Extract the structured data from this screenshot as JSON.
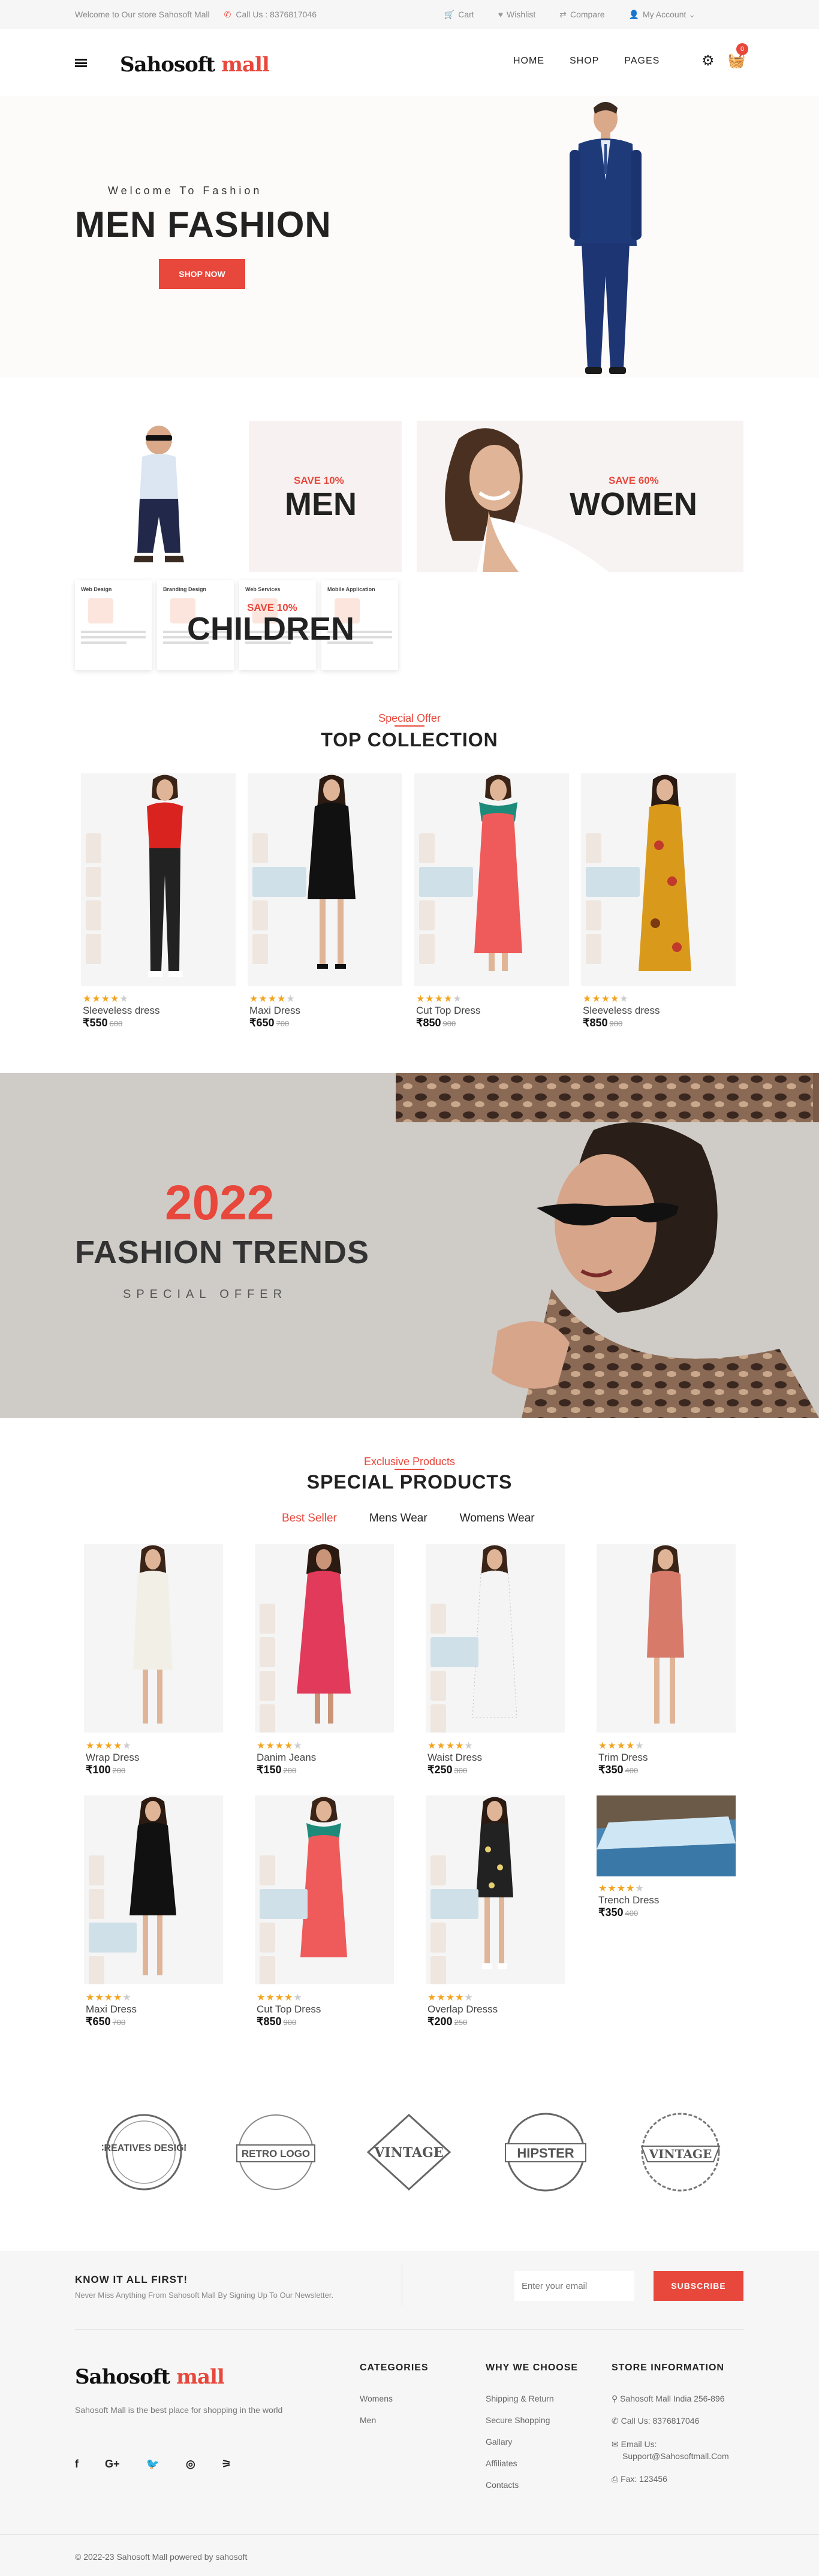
{
  "topbar": {
    "welcome": "Welcome to Our store Sahosoft Mall",
    "call": "Call Us : 8376817046",
    "cart": "Cart",
    "wishlist": "Wishlist",
    "compare": "Compare",
    "account": "My Account"
  },
  "header": {
    "logo_a": "Sahosoft",
    "logo_b": "mall",
    "nav": [
      "HOME",
      "SHOP",
      "PAGES"
    ],
    "cart_count": "0"
  },
  "hero": {
    "pre": "Welcome To Fashion",
    "title": "MEN FASHION",
    "cta": "SHOP NOW"
  },
  "categories": {
    "men": {
      "save": "SAVE 10%",
      "name": "MEN"
    },
    "women": {
      "save": "SAVE 60%",
      "name": "WOMEN"
    },
    "children": {
      "save": "SAVE 10%",
      "name": "CHILDREN"
    },
    "web_cards": [
      "Web Design",
      "Branding Design",
      "Web Services",
      "Mobile Application"
    ]
  },
  "top_collection": {
    "subtitle": "Special Offer",
    "title": "TOP COLLECTION",
    "products": [
      {
        "name": "Sleeveless dress",
        "price": "₹550",
        "old": "600"
      },
      {
        "name": "Maxi Dress",
        "price": "₹650",
        "old": "700"
      },
      {
        "name": "Cut Top Dress",
        "price": "₹850",
        "old": "900"
      },
      {
        "name": "Sleeveless dress",
        "price": "₹850",
        "old": "900"
      }
    ]
  },
  "trend": {
    "year": "2022",
    "title": "FASHION TRENDS",
    "sub": "SPECIAL OFFER"
  },
  "special": {
    "subtitle": "Exclusive Products",
    "title": "SPECIAL PRODUCTS",
    "tabs": [
      "Best Seller",
      "Mens Wear",
      "Womens Wear"
    ],
    "products": [
      {
        "name": "Wrap Dress",
        "price": "₹100",
        "old": "200"
      },
      {
        "name": "Danim Jeans",
        "price": "₹150",
        "old": "200"
      },
      {
        "name": "Waist Dress",
        "price": "₹250",
        "old": "300"
      },
      {
        "name": "Trim Dress",
        "price": "₹350",
        "old": "400"
      },
      {
        "name": "Maxi Dress",
        "price": "₹650",
        "old": "700"
      },
      {
        "name": "Cut Top Dress",
        "price": "₹850",
        "old": "900"
      },
      {
        "name": "Overlap Dresss",
        "price": "₹200",
        "old": "250"
      },
      {
        "name": "Trench Dress",
        "price": "₹350",
        "old": "400"
      }
    ]
  },
  "brands": [
    "CREATIVES DESIGN",
    "RETRO LOGO",
    "VINTAGE",
    "HIPSTER",
    "VINTAGE"
  ],
  "newsletter": {
    "title": "KNOW IT ALL FIRST!",
    "text": "Never Miss Anything From Sahosoft Mall By Signing Up To Our Newsletter.",
    "placeholder": "Enter your email",
    "button": "SUBSCRIBE"
  },
  "footer": {
    "about": "Sahosoft Mall is the best place for shopping in the world",
    "categories": {
      "title": "CATEGORIES",
      "items": [
        "Womens",
        "Men"
      ]
    },
    "why": {
      "title": "WHY WE CHOOSE",
      "items": [
        "Shipping & Return",
        "Secure Shopping",
        "Gallary",
        "Affiliates",
        "Contacts"
      ]
    },
    "store": {
      "title": "STORE INFORMATION",
      "address": "Sahosoft Mall India 256-896",
      "call": "Call Us: 8376817046",
      "email_label": "Email Us:",
      "email": "Support@Sahosoftmall.Com",
      "fax": "Fax: 123456"
    },
    "copyright": "© 2022-23 Sahosoft Mall powered by sahosoft"
  },
  "colors": {
    "accent": "#e8473b",
    "star": "#f2a41f"
  }
}
